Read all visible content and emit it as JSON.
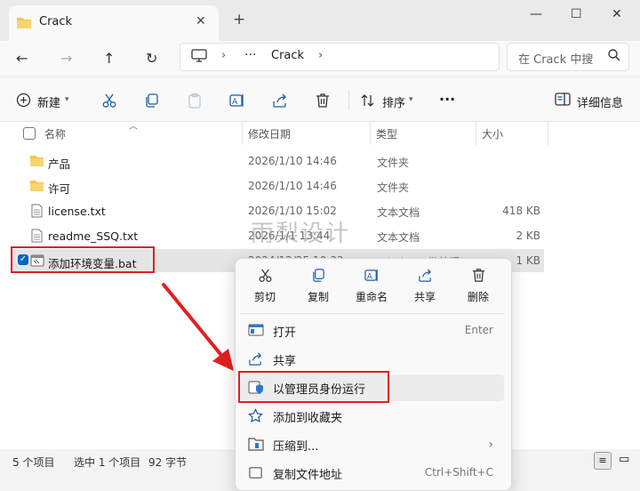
{
  "tab": {
    "title": "Crack"
  },
  "nav": {
    "path_root": "···",
    "path_current": "Crack",
    "search_placeholder": "在 Crack 中搜"
  },
  "toolbar": {
    "new_label": "新建",
    "sort_label": "排序",
    "more_label": "···",
    "details_label": "详细信息"
  },
  "columns": {
    "name": "名称",
    "date": "修改日期",
    "type": "类型",
    "size": "大小"
  },
  "files": [
    {
      "name": "产品",
      "date": "2026/1/10 14:46",
      "type": "文件夹",
      "size": "",
      "icon": "folder-icon"
    },
    {
      "name": "许可",
      "date": "2026/1/10 14:46",
      "type": "文件夹",
      "size": "",
      "icon": "folder-icon"
    },
    {
      "name": "license.txt",
      "date": "2026/1/10 15:02",
      "type": "文本文档",
      "size": "418 KB",
      "icon": "text-file-icon"
    },
    {
      "name": "readme_SSQ.txt",
      "date": "2026/1/1 13:44",
      "type": "文本文档",
      "size": "2 KB",
      "icon": "text-file-icon"
    },
    {
      "name": "添加环境变量.bat",
      "date": "2024/12/25 10:33",
      "type": "Windows 批处理...",
      "size": "1 KB",
      "icon": "batch-file-icon",
      "selected": true
    }
  ],
  "watermark": "雨梨设计",
  "context_menu": {
    "quick_actions": [
      {
        "label": "剪切",
        "icon": "cut-icon"
      },
      {
        "label": "复制",
        "icon": "copy-icon"
      },
      {
        "label": "重命名",
        "icon": "rename-icon"
      },
      {
        "label": "共享",
        "icon": "share-icon"
      },
      {
        "label": "删除",
        "icon": "delete-icon"
      }
    ],
    "items": [
      {
        "label": "打开",
        "shortcut": "Enter",
        "icon": "open-icon"
      },
      {
        "label": "共享",
        "shortcut": "",
        "icon": "share-icon"
      },
      {
        "label": "以管理员身份运行",
        "shortcut": "",
        "icon": "shield-icon"
      },
      {
        "label": "添加到收藏夹",
        "shortcut": "",
        "icon": "star-icon"
      },
      {
        "label": "压缩到...",
        "shortcut": "",
        "icon": "zip-icon"
      },
      {
        "label": "复制文件地址",
        "shortcut": "Ctrl+Shift+C",
        "icon": "path-icon"
      }
    ]
  },
  "status": {
    "count": "5 个项目",
    "selection": "选中 1 个项目",
    "size": "92 字节"
  },
  "colors": {
    "highlight": "#e02020",
    "folder": "#f4c542",
    "accent": "#0067c0"
  }
}
